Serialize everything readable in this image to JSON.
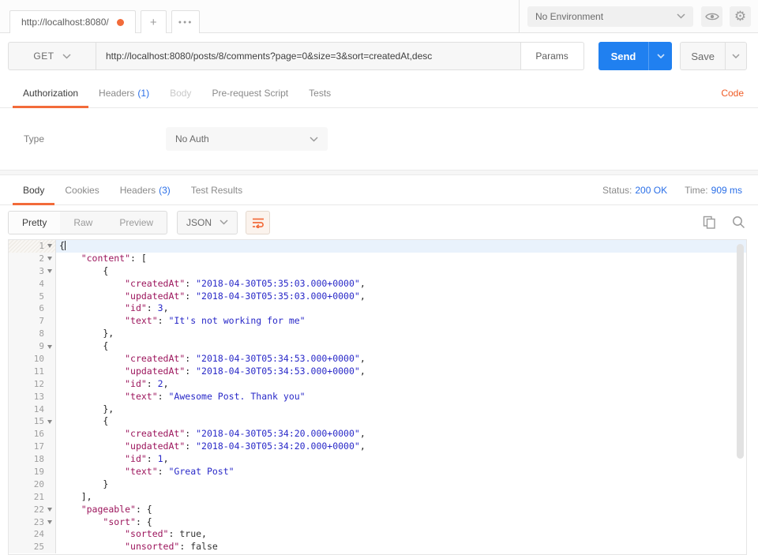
{
  "colors": {
    "accent_orange": "#f26b3a",
    "link_orange": "#ef5b25",
    "count_blue": "#2a6fe8",
    "send_blue": "#2080f0",
    "code_key": "#9c155c",
    "code_string": "#2929c8",
    "code_number": "#2929c8",
    "code_bool": "#333333",
    "code_punct": "#222222"
  },
  "topbar": {
    "tab_title": "http://localhost:8080/",
    "new_tab": "+",
    "more_tabs": "●●●",
    "environment_selected": "No Environment"
  },
  "request": {
    "method": "GET",
    "url": "http://localhost:8080/posts/8/comments?page=0&size=3&sort=createdAt,desc",
    "params_label": "Params",
    "send_label": "Send",
    "save_label": "Save",
    "code_link": "Code",
    "tabs": [
      {
        "label": "Authorization",
        "count": "",
        "active": true,
        "muted": false
      },
      {
        "label": "Headers",
        "count": "(1)",
        "active": false,
        "muted": false
      },
      {
        "label": "Body",
        "count": "",
        "active": false,
        "muted": true
      },
      {
        "label": "Pre-request Script",
        "count": "",
        "active": false,
        "muted": false
      },
      {
        "label": "Tests",
        "count": "",
        "active": false,
        "muted": false
      }
    ],
    "auth": {
      "type_label": "Type",
      "type_value": "No Auth"
    }
  },
  "response": {
    "tabs": [
      {
        "label": "Body",
        "count": "",
        "active": true
      },
      {
        "label": "Cookies",
        "count": "",
        "active": false
      },
      {
        "label": "Headers",
        "count": "(3)",
        "active": false
      },
      {
        "label": "Test Results",
        "count": "",
        "active": false
      }
    ],
    "status_label": "Status:",
    "status_value": "200 OK",
    "time_label": "Time:",
    "time_value": "909 ms",
    "view_modes": [
      {
        "label": "Pretty",
        "active": true
      },
      {
        "label": "Raw",
        "active": false
      },
      {
        "label": "Preview",
        "active": false
      }
    ],
    "format_selected": "JSON"
  },
  "code": {
    "lines": [
      {
        "num": 1,
        "fold": true,
        "active": true,
        "cursor": true,
        "segs": [
          [
            "p",
            "{"
          ]
        ]
      },
      {
        "num": 2,
        "fold": true,
        "segs": [
          [
            "p",
            "    "
          ],
          [
            "k",
            "\"content\""
          ],
          [
            "p",
            ": ["
          ]
        ]
      },
      {
        "num": 3,
        "fold": true,
        "segs": [
          [
            "p",
            "        {"
          ]
        ]
      },
      {
        "num": 4,
        "segs": [
          [
            "p",
            "            "
          ],
          [
            "k",
            "\"createdAt\""
          ],
          [
            "p",
            ": "
          ],
          [
            "s",
            "\"2018-04-30T05:35:03.000+0000\""
          ],
          [
            "p",
            ","
          ]
        ]
      },
      {
        "num": 5,
        "segs": [
          [
            "p",
            "            "
          ],
          [
            "k",
            "\"updatedAt\""
          ],
          [
            "p",
            ": "
          ],
          [
            "s",
            "\"2018-04-30T05:35:03.000+0000\""
          ],
          [
            "p",
            ","
          ]
        ]
      },
      {
        "num": 6,
        "segs": [
          [
            "p",
            "            "
          ],
          [
            "k",
            "\"id\""
          ],
          [
            "p",
            ": "
          ],
          [
            "n",
            "3"
          ],
          [
            "p",
            ","
          ]
        ]
      },
      {
        "num": 7,
        "segs": [
          [
            "p",
            "            "
          ],
          [
            "k",
            "\"text\""
          ],
          [
            "p",
            ": "
          ],
          [
            "s",
            "\"It's not working for me\""
          ]
        ]
      },
      {
        "num": 8,
        "segs": [
          [
            "p",
            "        },"
          ]
        ]
      },
      {
        "num": 9,
        "fold": true,
        "segs": [
          [
            "p",
            "        {"
          ]
        ]
      },
      {
        "num": 10,
        "segs": [
          [
            "p",
            "            "
          ],
          [
            "k",
            "\"createdAt\""
          ],
          [
            "p",
            ": "
          ],
          [
            "s",
            "\"2018-04-30T05:34:53.000+0000\""
          ],
          [
            "p",
            ","
          ]
        ]
      },
      {
        "num": 11,
        "segs": [
          [
            "p",
            "            "
          ],
          [
            "k",
            "\"updatedAt\""
          ],
          [
            "p",
            ": "
          ],
          [
            "s",
            "\"2018-04-30T05:34:53.000+0000\""
          ],
          [
            "p",
            ","
          ]
        ]
      },
      {
        "num": 12,
        "segs": [
          [
            "p",
            "            "
          ],
          [
            "k",
            "\"id\""
          ],
          [
            "p",
            ": "
          ],
          [
            "n",
            "2"
          ],
          [
            "p",
            ","
          ]
        ]
      },
      {
        "num": 13,
        "segs": [
          [
            "p",
            "            "
          ],
          [
            "k",
            "\"text\""
          ],
          [
            "p",
            ": "
          ],
          [
            "s",
            "\"Awesome Post. Thank you\""
          ]
        ]
      },
      {
        "num": 14,
        "segs": [
          [
            "p",
            "        },"
          ]
        ]
      },
      {
        "num": 15,
        "fold": true,
        "segs": [
          [
            "p",
            "        {"
          ]
        ]
      },
      {
        "num": 16,
        "segs": [
          [
            "p",
            "            "
          ],
          [
            "k",
            "\"createdAt\""
          ],
          [
            "p",
            ": "
          ],
          [
            "s",
            "\"2018-04-30T05:34:20.000+0000\""
          ],
          [
            "p",
            ","
          ]
        ]
      },
      {
        "num": 17,
        "segs": [
          [
            "p",
            "            "
          ],
          [
            "k",
            "\"updatedAt\""
          ],
          [
            "p",
            ": "
          ],
          [
            "s",
            "\"2018-04-30T05:34:20.000+0000\""
          ],
          [
            "p",
            ","
          ]
        ]
      },
      {
        "num": 18,
        "segs": [
          [
            "p",
            "            "
          ],
          [
            "k",
            "\"id\""
          ],
          [
            "p",
            ": "
          ],
          [
            "n",
            "1"
          ],
          [
            "p",
            ","
          ]
        ]
      },
      {
        "num": 19,
        "segs": [
          [
            "p",
            "            "
          ],
          [
            "k",
            "\"text\""
          ],
          [
            "p",
            ": "
          ],
          [
            "s",
            "\"Great Post\""
          ]
        ]
      },
      {
        "num": 20,
        "segs": [
          [
            "p",
            "        }"
          ]
        ]
      },
      {
        "num": 21,
        "segs": [
          [
            "p",
            "    ],"
          ]
        ]
      },
      {
        "num": 22,
        "fold": true,
        "segs": [
          [
            "p",
            "    "
          ],
          [
            "k",
            "\"pageable\""
          ],
          [
            "p",
            ": {"
          ]
        ]
      },
      {
        "num": 23,
        "fold": true,
        "segs": [
          [
            "p",
            "        "
          ],
          [
            "k",
            "\"sort\""
          ],
          [
            "p",
            ": {"
          ]
        ]
      },
      {
        "num": 24,
        "segs": [
          [
            "p",
            "            "
          ],
          [
            "k",
            "\"sorted\""
          ],
          [
            "p",
            ": "
          ],
          [
            "b",
            "true"
          ],
          [
            "p",
            ","
          ]
        ]
      },
      {
        "num": 25,
        "segs": [
          [
            "p",
            "            "
          ],
          [
            "k",
            "\"unsorted\""
          ],
          [
            "p",
            ": "
          ],
          [
            "b",
            "false"
          ]
        ]
      }
    ]
  }
}
